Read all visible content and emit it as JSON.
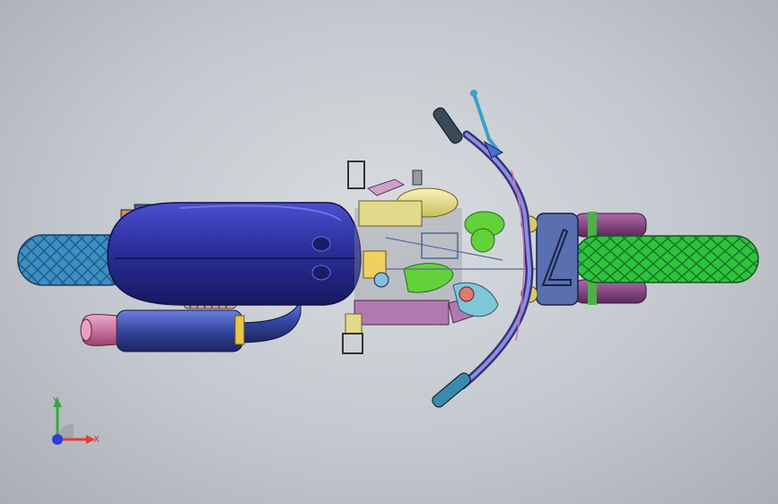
{
  "viewport": {
    "background_top": "#d9dde2",
    "background_bottom": "#a9aeb5"
  },
  "model": {
    "name": "motorcycle-assembly",
    "colors": {
      "rear_tire": "#2f7fb0",
      "front_tire": "#22b035",
      "fender": "#2b2f9a",
      "muffler": "#3a4fb0",
      "muffler_tip": "#c86b9a",
      "engine_yellow": "#e8de8c",
      "engine_green": "#62d13a",
      "handlebar": "#6b6bc8",
      "headlight": "#5a6fb0",
      "fork_tubes": "#7a3f78",
      "exhaust_pipe": "#7fc6d8"
    }
  },
  "triad": {
    "x_label": "X",
    "y_label": "Y",
    "x_color": "#e23b3b",
    "y_color": "#3aa83a",
    "z_color": "#2b3fd8"
  }
}
